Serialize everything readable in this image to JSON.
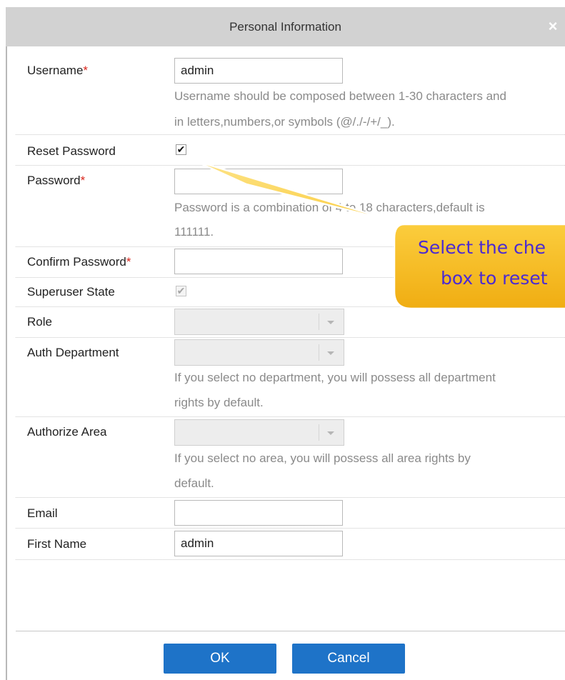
{
  "dialog": {
    "title": "Personal Information",
    "close_label": "×"
  },
  "form": {
    "required_mark": "*",
    "username": {
      "label": "Username",
      "value": "admin",
      "hint_line1": "Username should be composed between 1-30 characters and",
      "hint_line2": "in letters,numbers,or symbols (@/./-/+/_)."
    },
    "reset_password": {
      "label": "Reset Password",
      "checked": true,
      "check_glyph": "✔"
    },
    "password": {
      "label": "Password",
      "value": "",
      "hint_line1": "Password is a combination of 4 to 18 characters,default is",
      "hint_line2": "111111."
    },
    "confirm_password": {
      "label": "Confirm Password",
      "value": ""
    },
    "superuser_state": {
      "label": "Superuser State",
      "checked": true,
      "check_glyph": "✔"
    },
    "role": {
      "label": "Role",
      "value": ""
    },
    "auth_department": {
      "label": "Auth Department",
      "value": "",
      "hint_line1": "If you select no department, you will possess all department",
      "hint_line2": "rights by default."
    },
    "authorize_area": {
      "label": "Authorize Area",
      "value": "",
      "hint_line1": "If you select no area, you will possess all area rights by",
      "hint_line2": "default."
    },
    "email": {
      "label": "Email",
      "value": ""
    },
    "first_name": {
      "label": "First Name",
      "value": "admin"
    }
  },
  "buttons": {
    "ok": "OK",
    "cancel": "Cancel"
  },
  "callout": {
    "line1": "Select the che",
    "line2": "box to reset",
    "fill_color": "#f9c22b",
    "text_color": "#4b2ad2"
  },
  "colors": {
    "title_bar": "#d2d2d2",
    "button": "#1e73c8",
    "required": "#d9261c",
    "hint": "#8a8a8a"
  }
}
